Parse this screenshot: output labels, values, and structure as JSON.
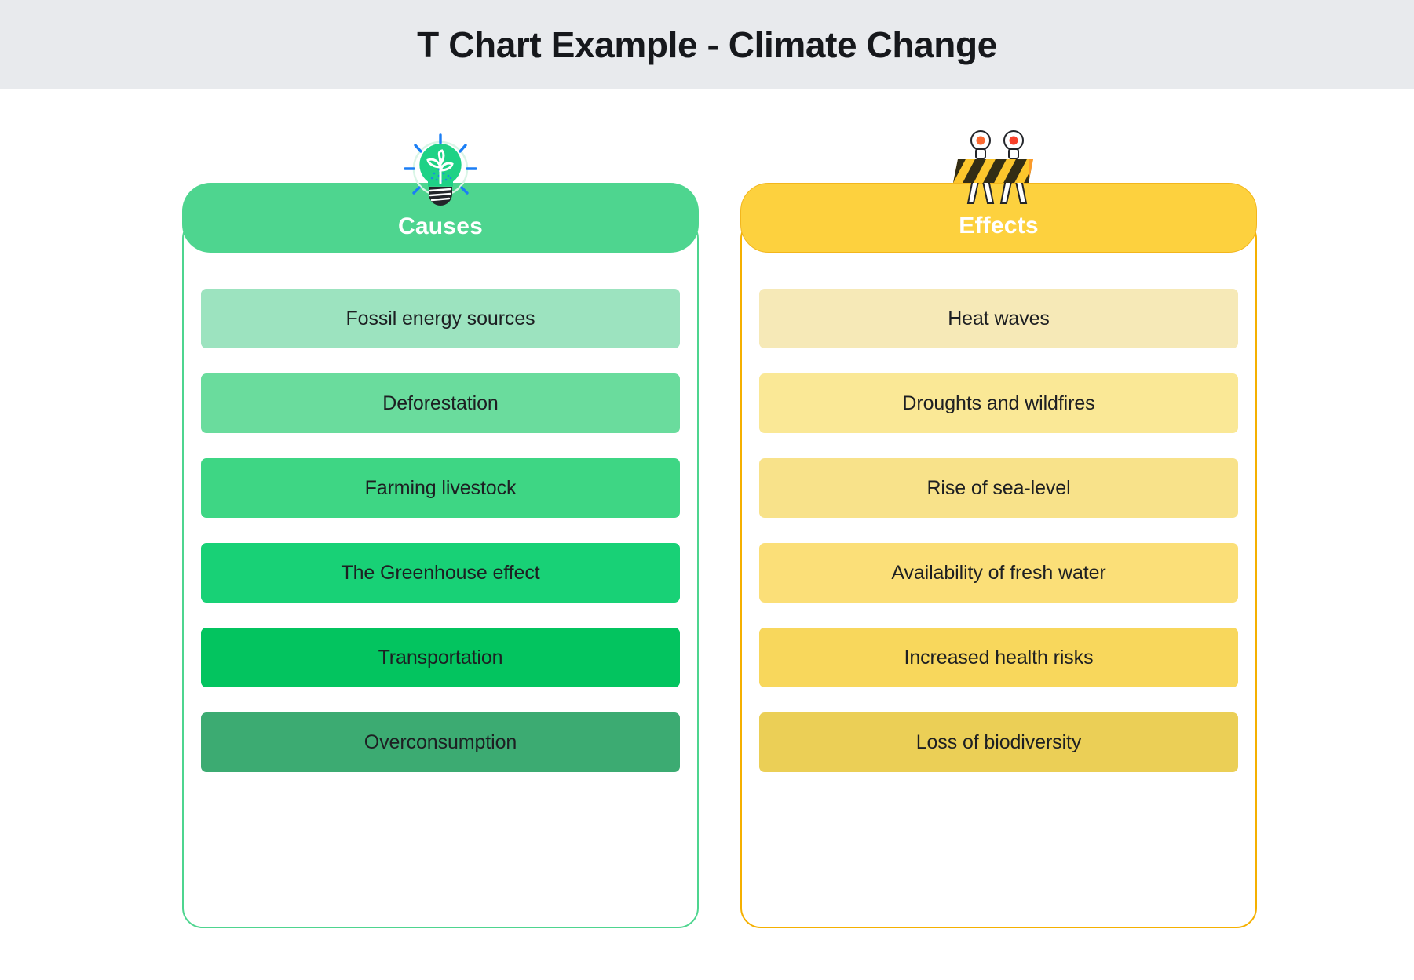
{
  "header": {
    "title": "T Chart Example - Climate Change",
    "background": "#e8eaed",
    "title_color": "#16181c"
  },
  "chart_data": {
    "type": "table",
    "title": "T Chart Example - Climate Change",
    "layout": "two-column t-chart",
    "columns": [
      {
        "label": "Causes",
        "icon": "lightbulb-sprout-icon",
        "accent": "#4ed58f",
        "border": "#4ed58f",
        "header_text_color": "#ffffff",
        "items": [
          {
            "label": "Fossil energy sources",
            "color": "#9ce3bf"
          },
          {
            "label": "Deforestation",
            "color": "#6adc9d"
          },
          {
            "label": "Farming livestock",
            "color": "#3ed684"
          },
          {
            "label": "The Greenhouse effect",
            "color": "#18d176"
          },
          {
            "label": "Transportation",
            "color": "#03c45f"
          },
          {
            "label": "Overconsumption",
            "color": "#3cab72"
          }
        ]
      },
      {
        "label": "Effects",
        "icon": "road-barrier-icon",
        "accent": "#fdd13e",
        "border": "#f5b000",
        "header_text_color": "#ffffff",
        "items": [
          {
            "label": "Heat waves",
            "color": "#f6e9b7"
          },
          {
            "label": "Droughts and wildfires",
            "color": "#fae896"
          },
          {
            "label": "Rise of sea-level",
            "color": "#f8e28a"
          },
          {
            "label": "Availability of fresh water",
            "color": "#fbdf78"
          },
          {
            "label": "Increased health risks",
            "color": "#f8d75c"
          },
          {
            "label": "Loss of biodiversity",
            "color": "#ebcf56"
          }
        ]
      }
    ]
  }
}
